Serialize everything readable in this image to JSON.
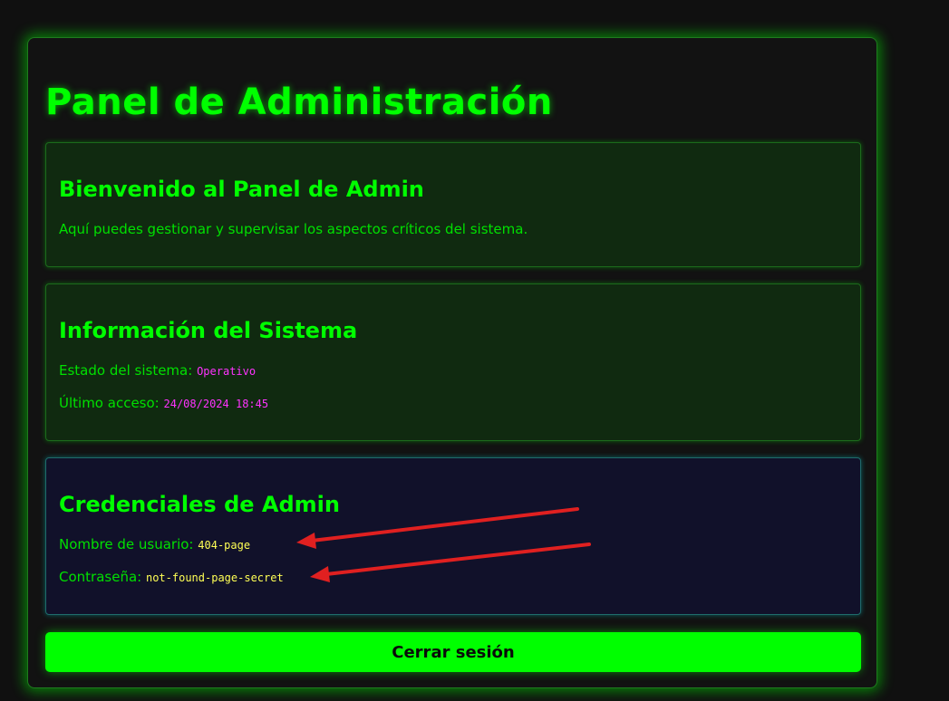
{
  "page": {
    "title": "Panel de Administración"
  },
  "welcome": {
    "heading": "Bienvenido al Panel de Admin",
    "text": "Aquí puedes gestionar y supervisar los aspectos críticos del sistema."
  },
  "system_info": {
    "heading": "Información del Sistema",
    "status_label": "Estado del sistema:",
    "status_value": "Operativo",
    "last_access_label": "Último acceso:",
    "last_access_value": "24/08/2024 18:45"
  },
  "credentials": {
    "heading": "Credenciales de Admin",
    "username_label": "Nombre de usuario:",
    "username_value": "404-page",
    "password_label": "Contraseña:",
    "password_value": "not-found-page-secret"
  },
  "actions": {
    "logout_label": "Cerrar sesión"
  },
  "colors": {
    "accent": "#00ff00",
    "value_magenta": "#ff33ff",
    "value_yellow": "#ffff55",
    "annotation_arrow": "#e02020"
  }
}
